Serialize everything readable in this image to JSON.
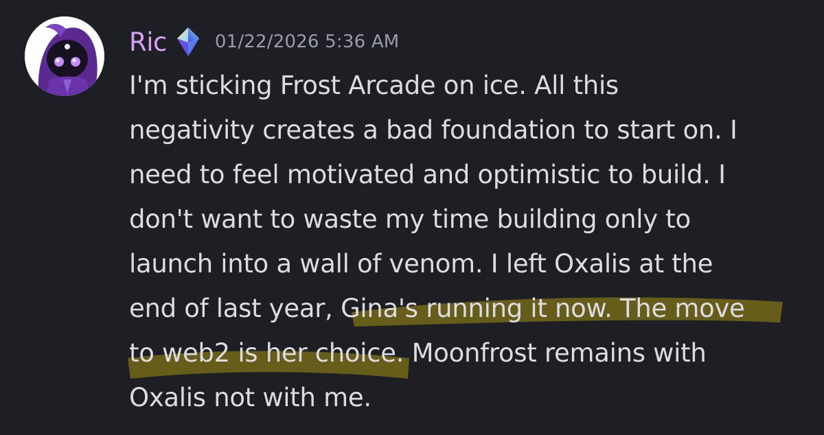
{
  "message": {
    "author": "Ric",
    "badge_icon": "gem-badge-icon",
    "timestamp": "01/22/2026 5:36 AM",
    "lines": [
      "I'm sticking Frost Arcade on ice. All this",
      "negativity creates a bad foundation to start on. I",
      "need to feel motivated and optimistic to build. I",
      "don't want to waste my time building only to",
      "launch into a wall of venom. I left Oxalis at the"
    ],
    "line6_before": "end of last year, ",
    "line6_highlight": "Gina's running it now. The move",
    "line7_highlight": "to web2 is her choice",
    "line7_after": ". Moonfrost remains with",
    "line8": "Oxalis not with me."
  },
  "colors": {
    "background": "#1e1f24",
    "username": "#d7a1f6",
    "timestamp": "#9b9da4",
    "text": "#dcdde2",
    "highlight": "#7a6d1d"
  }
}
